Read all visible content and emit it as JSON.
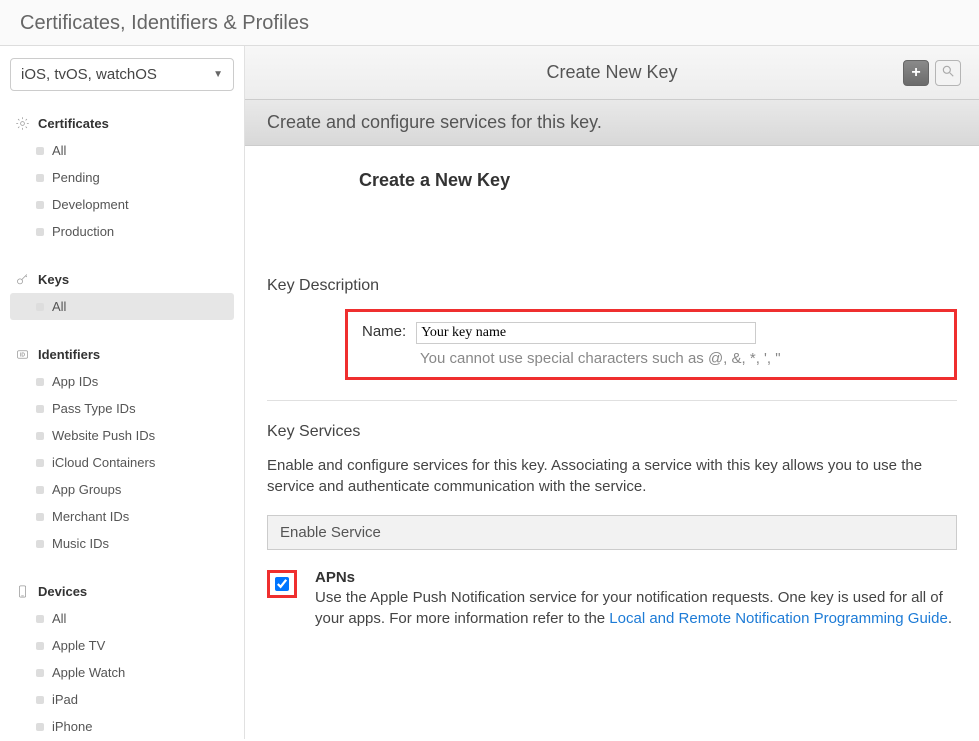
{
  "page_title": "Certificates, Identifiers & Profiles",
  "platform_selector": "iOS, tvOS, watchOS",
  "sidebar": {
    "certificates": {
      "label": "Certificates",
      "items": [
        {
          "label": "All"
        },
        {
          "label": "Pending"
        },
        {
          "label": "Development"
        },
        {
          "label": "Production"
        }
      ]
    },
    "keys": {
      "label": "Keys",
      "items": [
        {
          "label": "All",
          "selected": true
        }
      ]
    },
    "identifiers": {
      "label": "Identifiers",
      "items": [
        {
          "label": "App IDs"
        },
        {
          "label": "Pass Type IDs"
        },
        {
          "label": "Website Push IDs"
        },
        {
          "label": "iCloud Containers"
        },
        {
          "label": "App Groups"
        },
        {
          "label": "Merchant IDs"
        },
        {
          "label": "Music IDs"
        }
      ]
    },
    "devices": {
      "label": "Devices",
      "items": [
        {
          "label": "All"
        },
        {
          "label": "Apple TV"
        },
        {
          "label": "Apple Watch"
        },
        {
          "label": "iPad"
        },
        {
          "label": "iPhone"
        }
      ]
    }
  },
  "main": {
    "top_title": "Create New Key",
    "banner": "Create and configure services for this key.",
    "content_title": "Create a New Key",
    "key_description": {
      "heading": "Key Description",
      "name_label": "Name:",
      "name_value": "Your key name",
      "hint": "You cannot use special characters such as @, &, *, ', \""
    },
    "key_services": {
      "heading": "Key Services",
      "description": "Enable and configure services for this key. Associating a service with this key allows you to use the service and authenticate communication with the service.",
      "enable_header": "Enable Service",
      "apns": {
        "name": "APNs",
        "desc_part1": "Use the Apple Push Notification service for your notification requests. One key is used for all of your apps. For more information refer to the ",
        "link_text": "Local and Remote Notification Programming Guide",
        "desc_part2": ".",
        "checked": true
      }
    }
  }
}
